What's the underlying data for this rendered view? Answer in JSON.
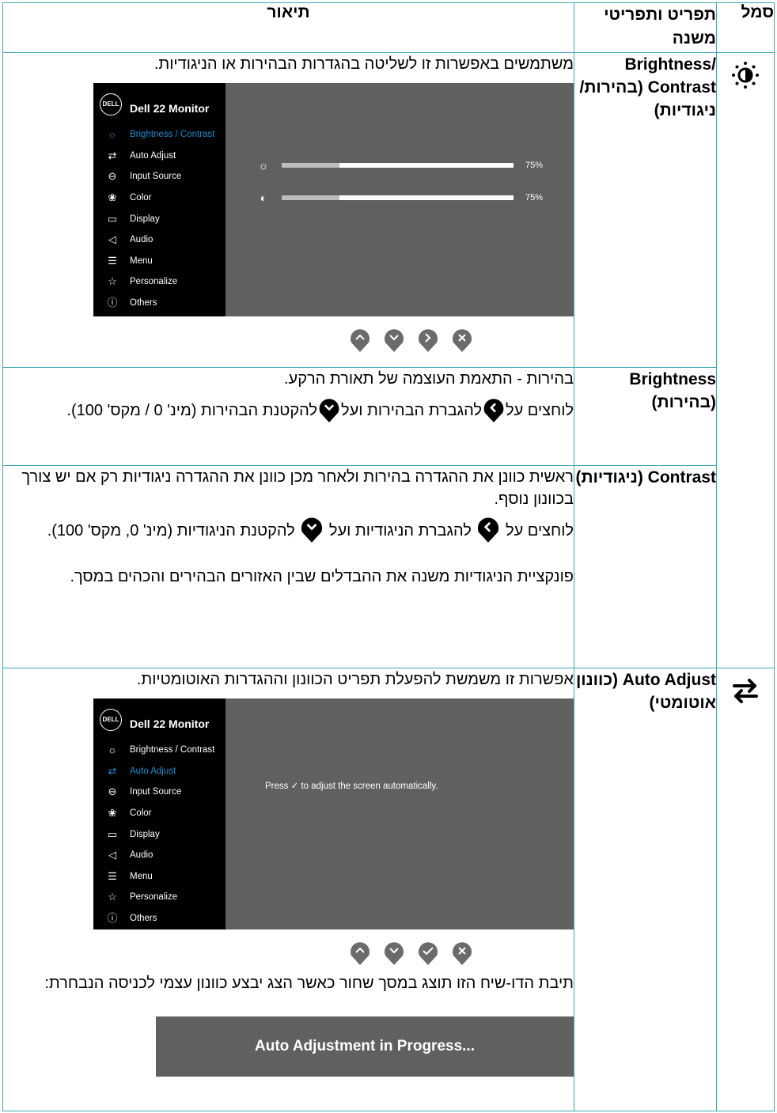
{
  "headers": {
    "description": "תיאור",
    "item": "תפריט ותפריטי משנה",
    "symbol": "סמל"
  },
  "osd": {
    "model": "Dell 22 Monitor",
    "logo": "DELL",
    "menu": [
      {
        "label": "Brightness / Contrast",
        "icon": "brightness-icon"
      },
      {
        "label": "Auto Adjust",
        "icon": "auto-adjust-icon"
      },
      {
        "label": "Input Source",
        "icon": "input-source-icon"
      },
      {
        "label": "Color",
        "icon": "color-icon"
      },
      {
        "label": "Display",
        "icon": "display-icon"
      },
      {
        "label": "Audio",
        "icon": "audio-icon"
      },
      {
        "label": "Menu",
        "icon": "menu-icon"
      },
      {
        "label": "Personalize",
        "icon": "personalize-icon"
      },
      {
        "label": "Others",
        "icon": "others-icon"
      }
    ],
    "brightness": {
      "text": "75%",
      "percent": 75
    },
    "contrast": {
      "text": "75%",
      "percent": 75
    },
    "press_prefix": "Press",
    "press_suffix": "to adjust the screen automatically.",
    "selected_color": "#1e8bd1"
  },
  "rows": {
    "bc": {
      "item": "Brightness/ Contrast (בהירות/ ניגודיות)",
      "desc": "משתמשים באפשרות זו לשליטה בהגדרות הבהירות או הניגודיות."
    },
    "brightness": {
      "item": "Brightness (בהירות)",
      "p1": "בהירות - התאמת העוצמה של תאורת הרקע.",
      "p2a": "לוחצים על",
      "p2b": "להגברת הבהירות ועל",
      "p2c": "להקטנת הבהירות (מינ' 0 / מקס' 100)."
    },
    "contrast": {
      "item": "Contrast (ניגודיות)",
      "p1": "ראשית כוונן את ההגדרה בהירות ולאחר מכן כוונן את ההגדרה ניגודיות רק אם יש צורך בכוונון נוסף.",
      "p2a": "לוחצים על",
      "p2b": "להגברת הניגודיות ועל",
      "p2c": "להקטנת הניגודיות (מינ' 0, מקס' 100).",
      "p3": "פונקציית הניגודיות משנה את ההבדלים שבין האזורים הבהירים והכהים במסך."
    },
    "auto": {
      "item": "Auto Adjust (כוונון אוטומטי)",
      "desc": "אפשרות זו משמשת להפעלת תפריט הכוונון וההגדרות האוטומטיות.",
      "p2": "תיבת הדו-שיח הזו תוצג במסך שחור כאשר הצג יבצע כוונון עצמי לכניסה הנבחרת:",
      "banner": "Auto Adjustment in Progress..."
    }
  },
  "colors": {
    "border": "#3ea7b7",
    "osd_bg": "#606060",
    "button": "#6b6b6b"
  }
}
